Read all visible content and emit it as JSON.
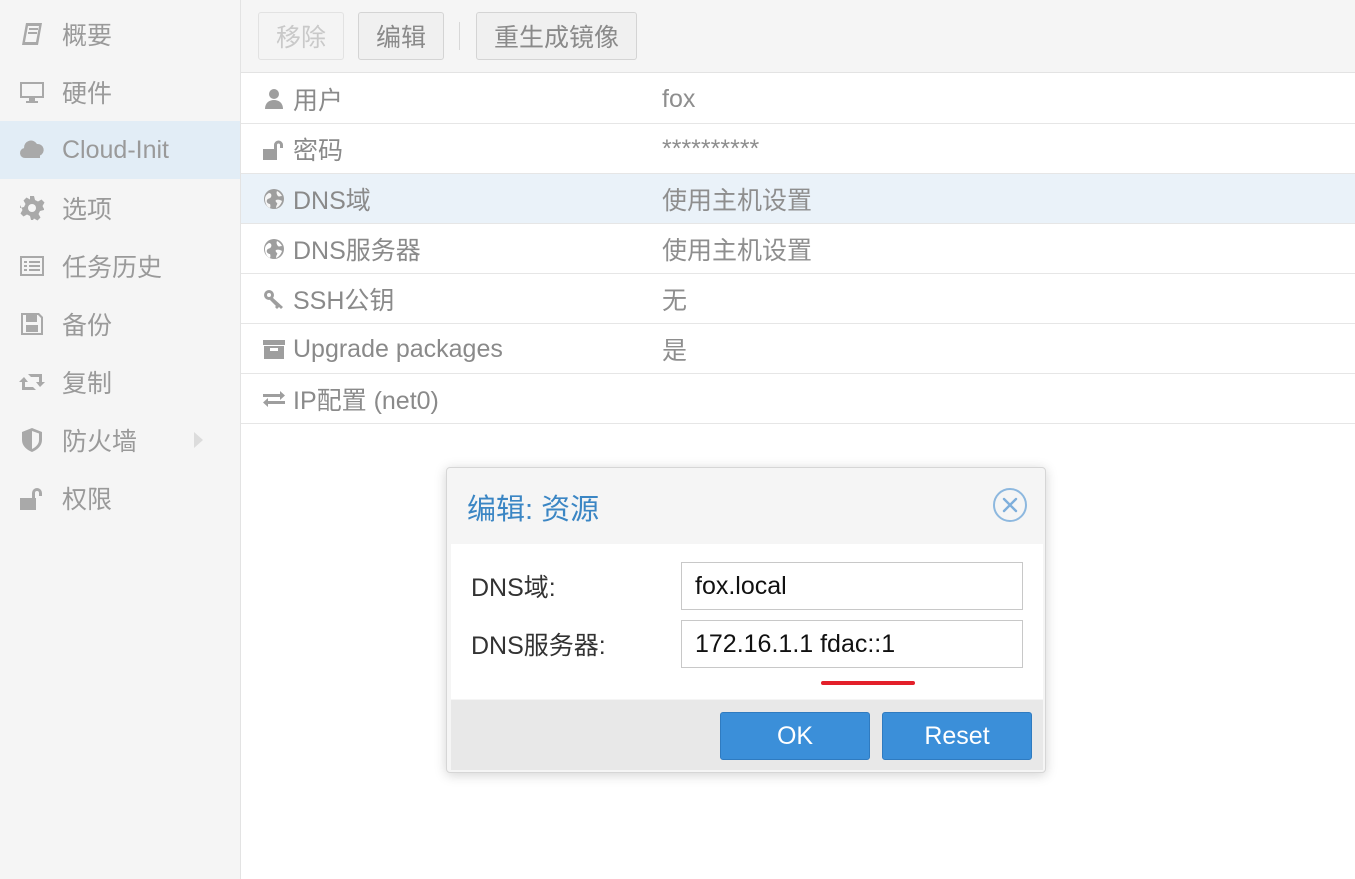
{
  "sidebar": {
    "items": [
      {
        "label": "概要",
        "icon": "book-icon"
      },
      {
        "label": "硬件",
        "icon": "monitor-icon"
      },
      {
        "label": "Cloud-Init",
        "icon": "cloud-icon",
        "active": true
      },
      {
        "label": "选项",
        "icon": "gear-icon"
      },
      {
        "label": "任务历史",
        "icon": "list-icon"
      },
      {
        "label": "备份",
        "icon": "floppy-icon"
      },
      {
        "label": "复制",
        "icon": "retweet-icon"
      },
      {
        "label": "防火墙",
        "icon": "shield-icon"
      },
      {
        "label": "权限",
        "icon": "unlock-icon"
      }
    ]
  },
  "toolbar": {
    "remove_label": "移除",
    "edit_label": "编辑",
    "regenerate_label": "重生成镜像"
  },
  "grid": {
    "rows": [
      {
        "key": "用户",
        "value": "fox",
        "icon": "user-icon"
      },
      {
        "key": "密码",
        "value": "**********",
        "icon": "unlock-icon"
      },
      {
        "key": "DNS域",
        "value": "使用主机设置",
        "icon": "globe-icon",
        "selected": true
      },
      {
        "key": "DNS服务器",
        "value": "使用主机设置",
        "icon": "globe-icon"
      },
      {
        "key": "SSH公钥",
        "value": "无",
        "icon": "key-icon"
      },
      {
        "key": "Upgrade packages",
        "value": "是",
        "icon": "archive-icon"
      },
      {
        "key": "IP配置 (net0)",
        "value": "",
        "icon": "exchange-icon"
      }
    ]
  },
  "dialog": {
    "title": "编辑: 资源",
    "dns_domain_label": "DNS域:",
    "dns_domain_value": "fox.local",
    "dns_servers_label": "DNS服务器:",
    "dns_servers_value": "172.16.1.1 fdac::1",
    "ok_label": "OK",
    "reset_label": "Reset"
  },
  "colors": {
    "accent": "#3b8fd9",
    "title_blue": "#3b86c4",
    "selected_row": "#eaf2f9",
    "annotation_red": "#e3202a"
  }
}
